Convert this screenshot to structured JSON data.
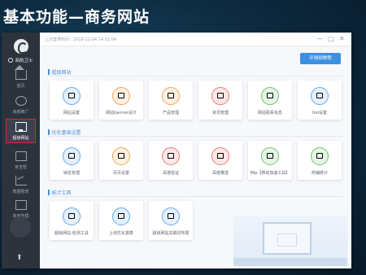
{
  "slide": {
    "title": "基本功能—商务网站"
  },
  "topbar": {
    "last_login": "上次登录时间：2019-11-04 14:52:04",
    "minimize": "—",
    "maximize": "□",
    "close": "✕"
  },
  "sidebar": {
    "logo_text": "商航卫士",
    "items": [
      {
        "label": "首页",
        "icon": "home-icon"
      },
      {
        "label": "商航推广",
        "icon": "globe-icon"
      },
      {
        "label": "超级网站",
        "icon": "monitor-icon",
        "active": true
      },
      {
        "label": "官宣帮",
        "icon": "display-icon"
      },
      {
        "label": "数据报表",
        "icon": "chart-icon"
      },
      {
        "label": "商家管理",
        "icon": "shop-icon"
      }
    ],
    "scroll_up": "⬆"
  },
  "main": {
    "video_button": "环视频教程",
    "sections": [
      {
        "title": "超级网站",
        "cards": [
          {
            "label": "网站设置",
            "color": "blue"
          },
          {
            "label": "网站banner设计",
            "color": "orange"
          },
          {
            "label": "产品管理",
            "color": "orange"
          },
          {
            "label": "资讯管理",
            "color": "red"
          },
          {
            "label": "网站联系信息",
            "color": "green"
          },
          {
            "label": "Uei设置",
            "color": "blue"
          }
        ]
      },
      {
        "title": "优化基础设置",
        "cards": [
          {
            "label": "域名管理",
            "color": "blue"
          },
          {
            "label": "页页设置",
            "color": "orange"
          },
          {
            "label": "百度验证",
            "color": "red"
          },
          {
            "label": "百度推送",
            "color": "red"
          },
          {
            "label": "Mip【移动加速工具】",
            "color": "green"
          },
          {
            "label": "商铺统计",
            "color": "green"
          }
        ]
      },
      {
        "title": "统计工具",
        "cards": [
          {
            "label": "超级网站-检测工具",
            "color": "blue"
          },
          {
            "label": "上线优化报表",
            "color": "blue"
          },
          {
            "label": "超级网站关键词布局",
            "color": "blue"
          }
        ]
      }
    ]
  }
}
